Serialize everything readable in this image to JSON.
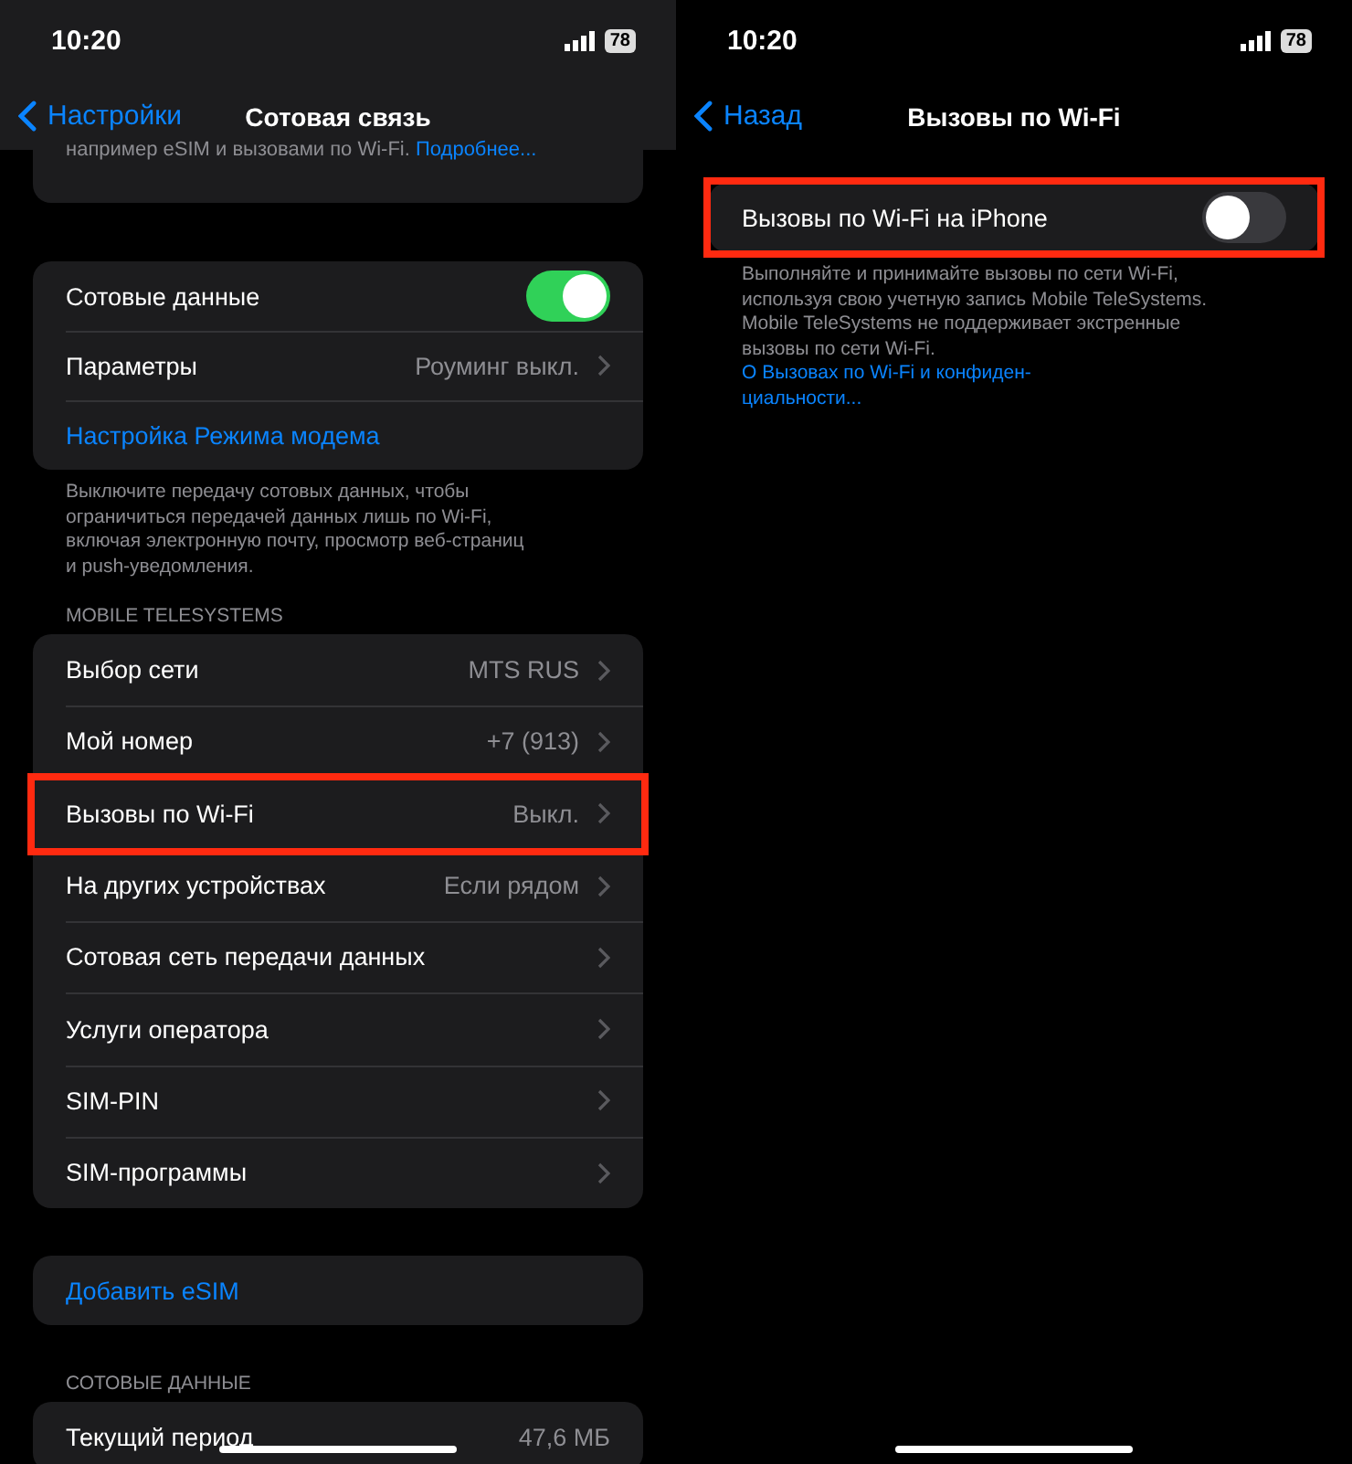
{
  "screens": [
    {
      "status": {
        "time": "10:20",
        "battery": "78"
      },
      "nav": {
        "back": "Настройки",
        "title": "Сотовая связь",
        "shaded": true
      },
      "top_note": {
        "text": "например eSIM и вызовами по Wi-Fi.",
        "link": "Подробнее..."
      },
      "groups": [
        {
          "rows": [
            {
              "kind": "toggle",
              "label": "Сотовые данные",
              "on": true,
              "highlighted": false
            },
            {
              "kind": "nav",
              "label": "Параметры",
              "value": "Роуминг выкл.",
              "highlighted": false
            },
            {
              "kind": "link",
              "label": "Настройка Режима модема",
              "highlighted": false
            }
          ],
          "footer": {
            "text": "Выключите передачу сотовых данных, чтобы ограничиться передачей данных лишь по Wi-Fi, включая электронную почту, просмотр веб-страниц и push-уведомления."
          }
        },
        {
          "header": "MOBILE TELESYSTEMS",
          "rows": [
            {
              "kind": "nav",
              "label": "Выбор сети",
              "value": "MTS RUS",
              "highlighted": false
            },
            {
              "kind": "nav",
              "label": "Мой номер",
              "value": "+7 (913)",
              "highlighted": false
            },
            {
              "kind": "nav",
              "label": "Вызовы по Wi-Fi",
              "value": "Выкл.",
              "highlighted": true
            },
            {
              "kind": "nav",
              "label": "На других устройствах",
              "value": "Если рядом",
              "highlighted": false
            },
            {
              "kind": "nav",
              "label": "Сотовая сеть передачи данных",
              "highlighted": false
            },
            {
              "kind": "nav",
              "label": "Услуги оператора",
              "highlighted": false
            },
            {
              "kind": "nav",
              "label": "SIM-PIN",
              "highlighted": false
            },
            {
              "kind": "nav",
              "label": "SIM-программы",
              "highlighted": false
            }
          ]
        },
        {
          "rows": [
            {
              "kind": "link",
              "label": "Добавить eSIM",
              "highlighted": false
            }
          ]
        },
        {
          "header": "СОТОВЫЕ ДАННЫЕ",
          "rows": [
            {
              "kind": "value",
              "label": "Текущий период",
              "value": "47,6 МБ",
              "highlighted": false
            }
          ]
        }
      ]
    },
    {
      "status": {
        "time": "10:20",
        "battery": "78"
      },
      "nav": {
        "back": "Назад",
        "title": "Вызовы по Wi-Fi",
        "shaded": false
      },
      "groups": [
        {
          "rows": [
            {
              "kind": "toggle",
              "label": "Вызовы по Wi-Fi на iPhone",
              "on": false,
              "highlighted": true
            }
          ],
          "footer": {
            "text": "Выполняйте и принимайте вызовы по сети Wi-Fi, используя свою учетную запись Mobile TeleSystems. Mobile TeleSystems не поддерживает экстренные вызовы по сети Wi-Fi.",
            "link_lines": [
              "О Вызовах по Wi-Fi и конфиден-",
              "циальности..."
            ]
          }
        }
      ]
    }
  ]
}
